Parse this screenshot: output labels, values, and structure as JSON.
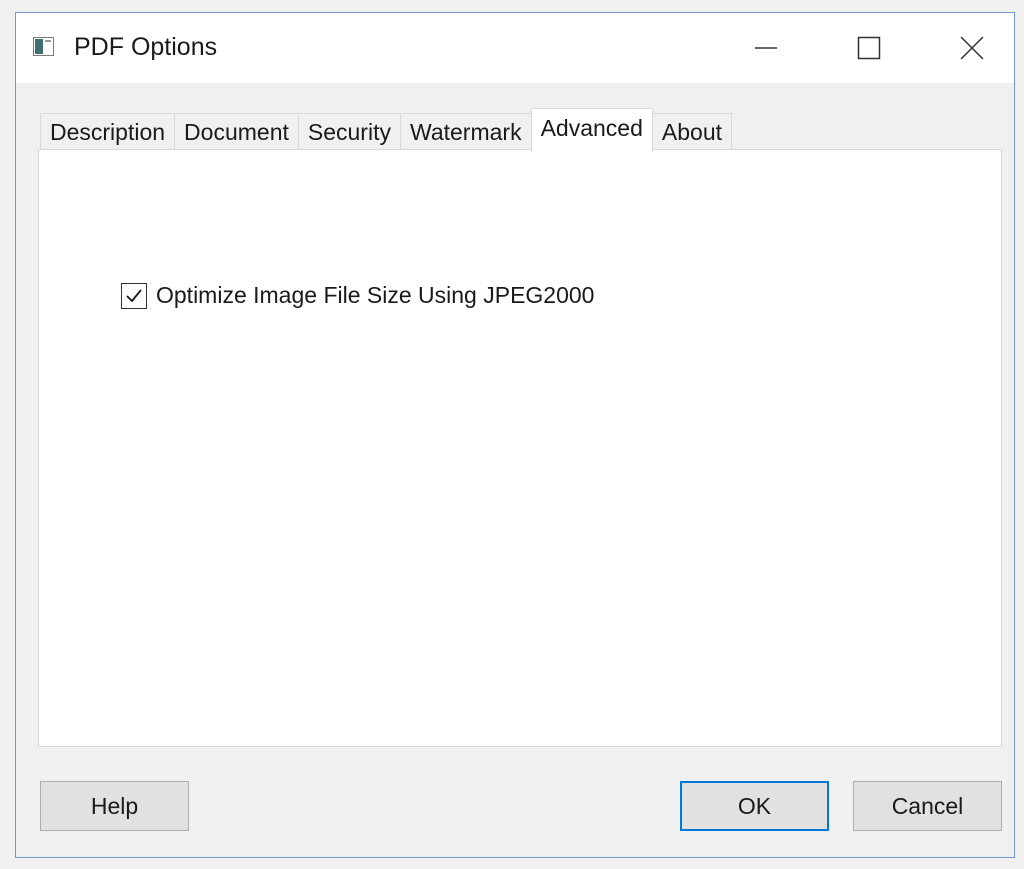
{
  "window": {
    "title": "PDF Options",
    "app_icon": "app-window-icon",
    "caption_buttons": {
      "minimize": "minimize-icon",
      "maximize": "maximize-icon",
      "close": "close-icon"
    }
  },
  "tabs": [
    {
      "label": "Description",
      "active": false
    },
    {
      "label": "Document",
      "active": false
    },
    {
      "label": "Security",
      "active": false
    },
    {
      "label": "Watermark",
      "active": false
    },
    {
      "label": "Advanced",
      "active": true
    },
    {
      "label": "About",
      "active": false
    }
  ],
  "advanced": {
    "optimize_jpeg2000": {
      "label": "Optimize Image File Size Using JPEG2000",
      "checked": true
    }
  },
  "buttons": {
    "help": "Help",
    "ok": "OK",
    "cancel": "Cancel"
  },
  "colors": {
    "window_border": "#6f9bd1",
    "default_button_border": "#0078d7"
  }
}
